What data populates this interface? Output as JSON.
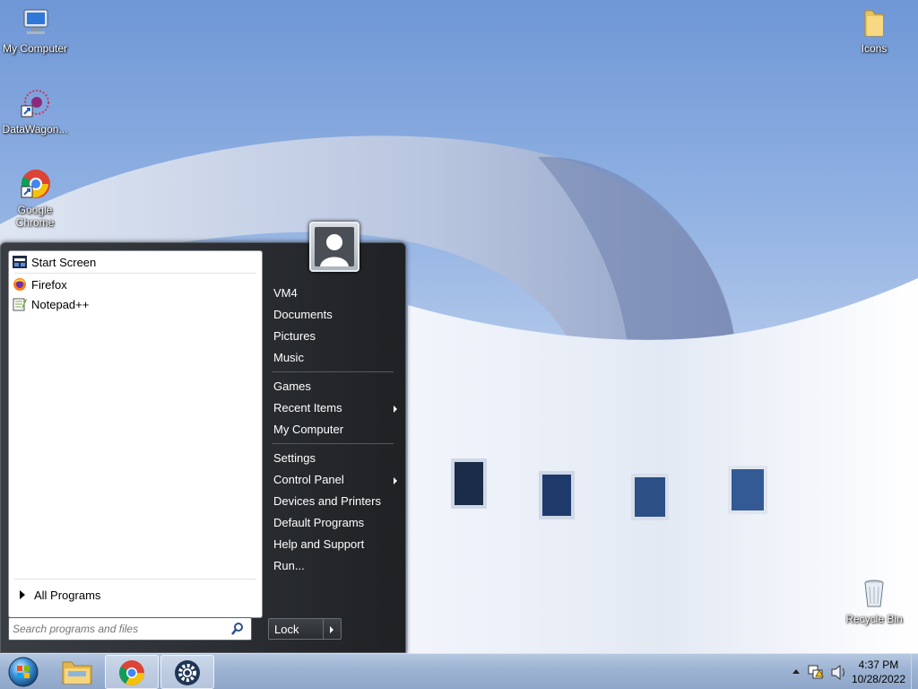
{
  "desktop": {
    "icons": [
      {
        "label": "My Computer",
        "icon": "computer-icon"
      },
      {
        "label": "DataWagon...",
        "icon": "datawagon-icon"
      },
      {
        "label": "Google Chrome",
        "icon": "chrome-icon"
      },
      {
        "label": "Icons",
        "icon": "folder-icon"
      },
      {
        "label": "Recycle Bin",
        "icon": "recycle-bin-icon"
      }
    ]
  },
  "start_menu": {
    "pinned": [
      {
        "label": "Start Screen",
        "icon": "start-screen-icon"
      },
      {
        "label": "Firefox",
        "icon": "firefox-icon"
      },
      {
        "label": "Notepad++",
        "icon": "notepad-plus-plus-icon"
      }
    ],
    "all_programs": "All Programs",
    "search_placeholder": "Search programs and files",
    "right_links": [
      {
        "label": "VM4",
        "submenu": false
      },
      {
        "label": "Documents",
        "submenu": false
      },
      {
        "label": "Pictures",
        "submenu": false
      },
      {
        "label": "Music",
        "submenu": false
      },
      {
        "label": "Games",
        "submenu": false
      },
      {
        "label": "Recent Items",
        "submenu": true
      },
      {
        "label": "My Computer",
        "submenu": false
      },
      {
        "label": "Settings",
        "submenu": false
      },
      {
        "label": "Control Panel",
        "submenu": true
      },
      {
        "label": "Devices and Printers",
        "submenu": false
      },
      {
        "label": "Default Programs",
        "submenu": false
      },
      {
        "label": "Help and Support",
        "submenu": false
      },
      {
        "label": "Run...",
        "submenu": false
      }
    ],
    "lock_label": "Lock"
  },
  "taskbar": {
    "buttons": [
      {
        "name": "file-explorer",
        "icon": "file-explorer-icon"
      },
      {
        "name": "google-chrome",
        "icon": "chrome-icon"
      },
      {
        "name": "settings",
        "icon": "gear-icon"
      }
    ],
    "clock": {
      "time": "4:37 PM",
      "date": "10/28/2022"
    }
  },
  "colors": {
    "menu_dark": "#2a2d31",
    "taskbar": "#9db3d3",
    "sky": "#8fb0e2"
  }
}
